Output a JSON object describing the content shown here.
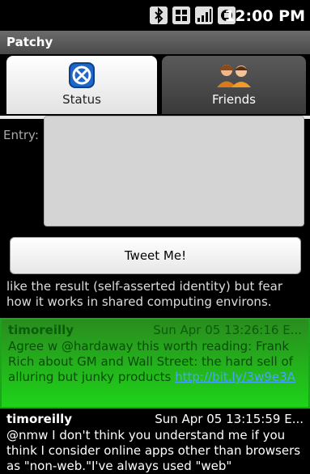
{
  "status_bar": {
    "time": "12:00 PM",
    "icons": [
      "bluetooth-icon",
      "network-icon",
      "signal-icon",
      "battery-icon"
    ]
  },
  "app": {
    "title": "Patchy"
  },
  "tabs": [
    {
      "label": "Status",
      "icon": "status-icon",
      "selected": true
    },
    {
      "label": "Friends",
      "icon": "friends-icon",
      "selected": false
    }
  ],
  "entry": {
    "label": "Entry:",
    "value": ""
  },
  "tweet_button": {
    "label": "Tweet Me!"
  },
  "timeline": {
    "partial_text": "like the result (self-asserted identity) but fear how it works in shared computing environs.",
    "items": [
      {
        "user": "timoreilly",
        "time": "Sun Apr 05 13:26:16 E...",
        "text": "Agree w @hardaway this worth reading: Frank Rich about GM and Wall Street: the hard sell of alluring but junky products ",
        "link": "http://bit.ly/3w9e3A",
        "highlighted": true
      },
      {
        "user": "timoreilly",
        "time": "Sun Apr 05 13:15:59 E...",
        "text": "@nmw I don't think you understand me if you think I consider online apps other than browsers as \"non-web.\"I've always used \"web\"",
        "highlighted": false
      }
    ]
  },
  "colors": {
    "highlight_green": "#1ed31a",
    "link_blue": "#4aa3ff"
  }
}
